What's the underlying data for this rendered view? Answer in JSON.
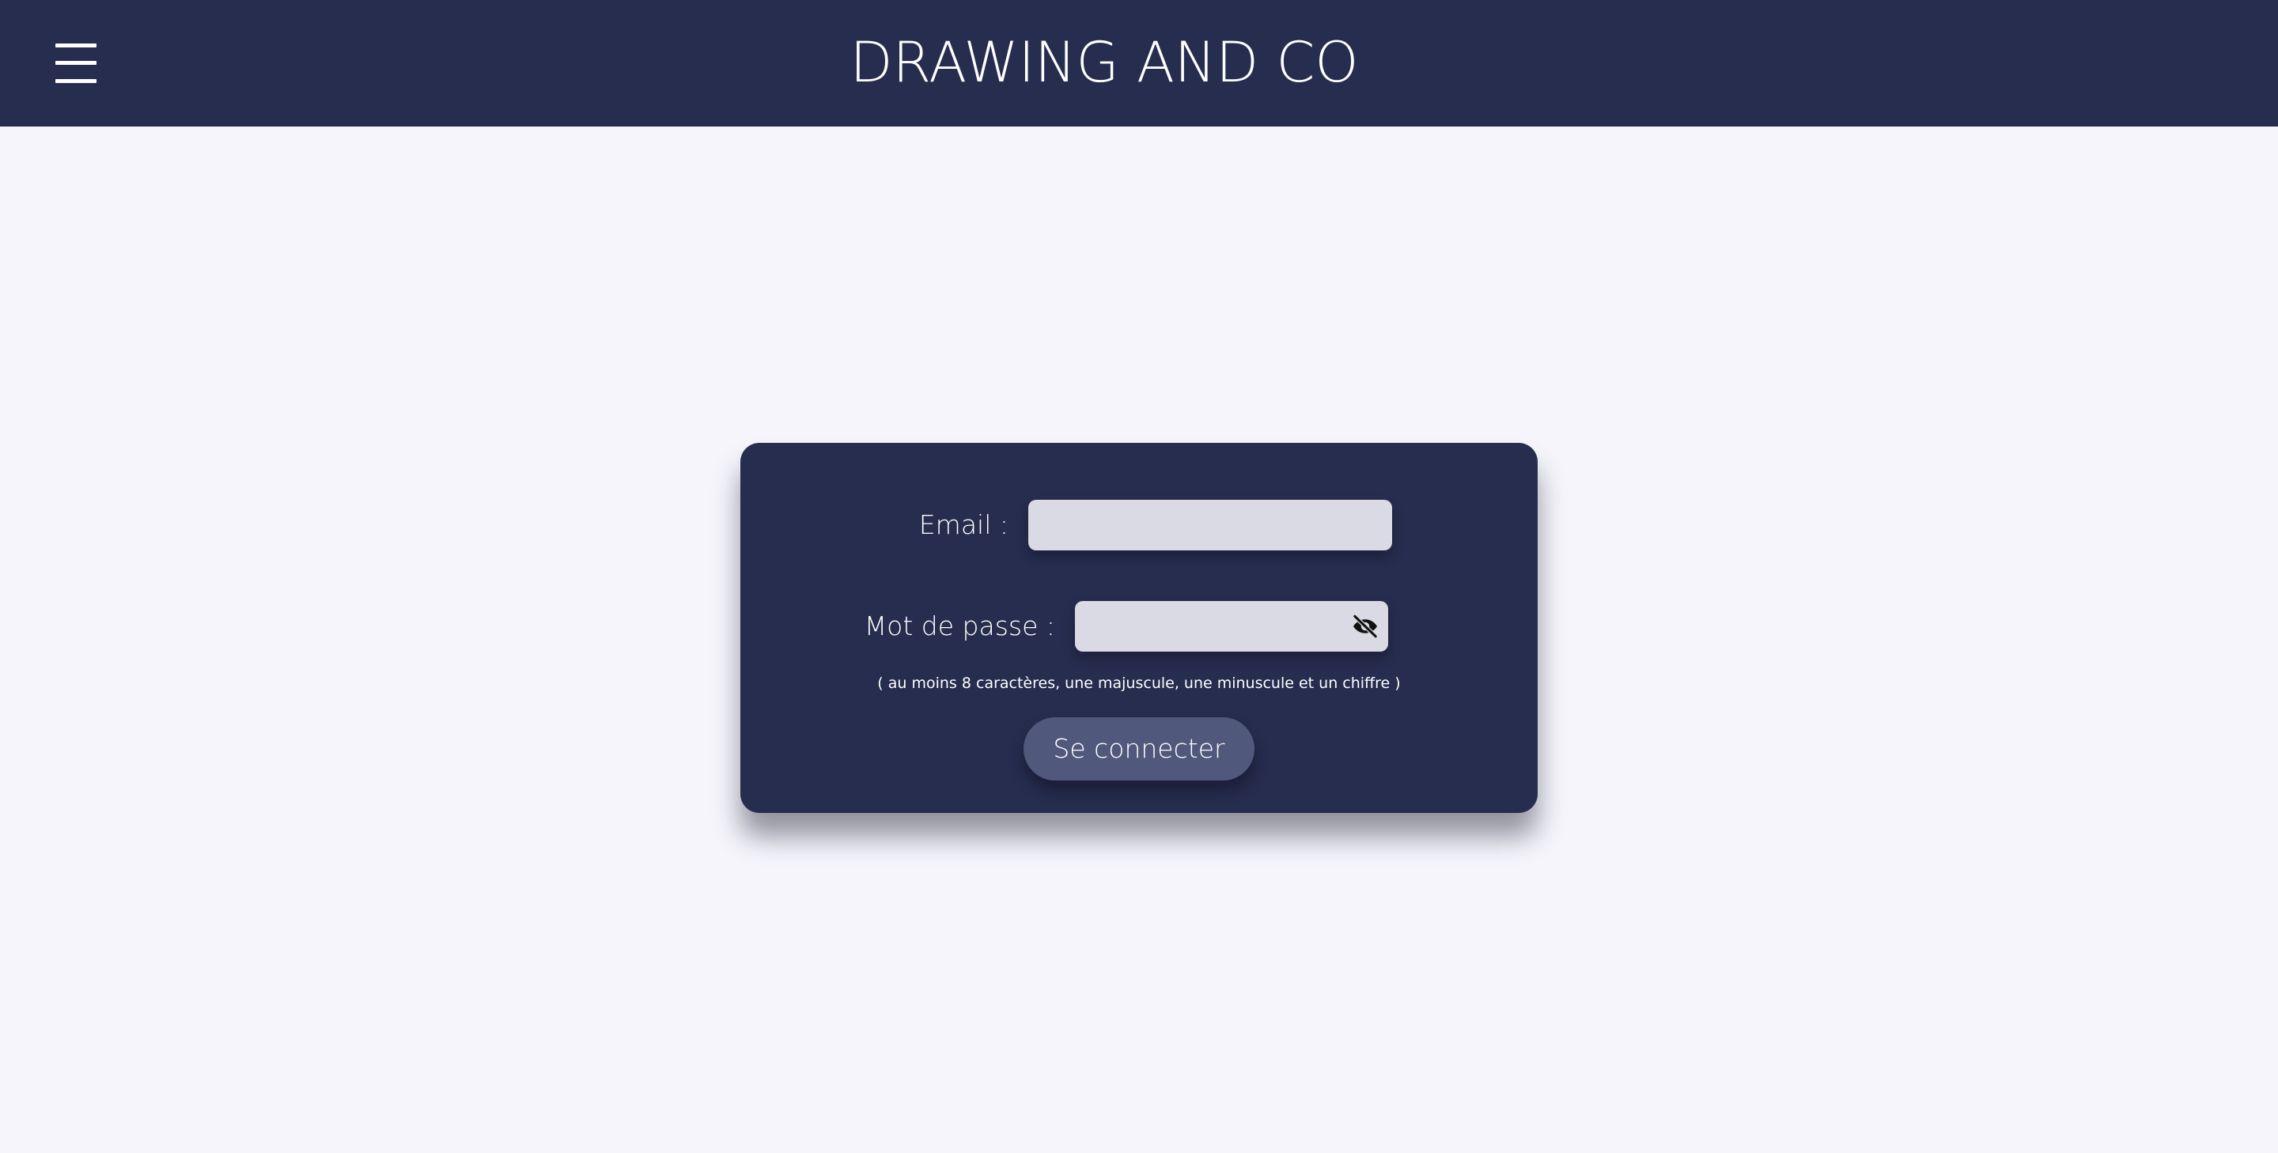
{
  "header": {
    "title": "DRAWING AND CO",
    "menu_icon": "hamburger-menu-icon"
  },
  "login": {
    "email_label": "Email :",
    "email_value": "",
    "password_label": "Mot de passe :",
    "password_value": "",
    "password_toggle_icon": "eye-slash-icon",
    "password_hint": "( au moins 8 caractères, une majuscule, une minuscule et un chiffre )",
    "submit_label": "Se connecter"
  },
  "colors": {
    "header_bg": "#272d4e",
    "page_bg": "#f5f5fb",
    "card_bg": "#272d4e",
    "input_bg": "#d9dae3",
    "button_bg": "#50587c",
    "text_light": "#ffffff"
  }
}
